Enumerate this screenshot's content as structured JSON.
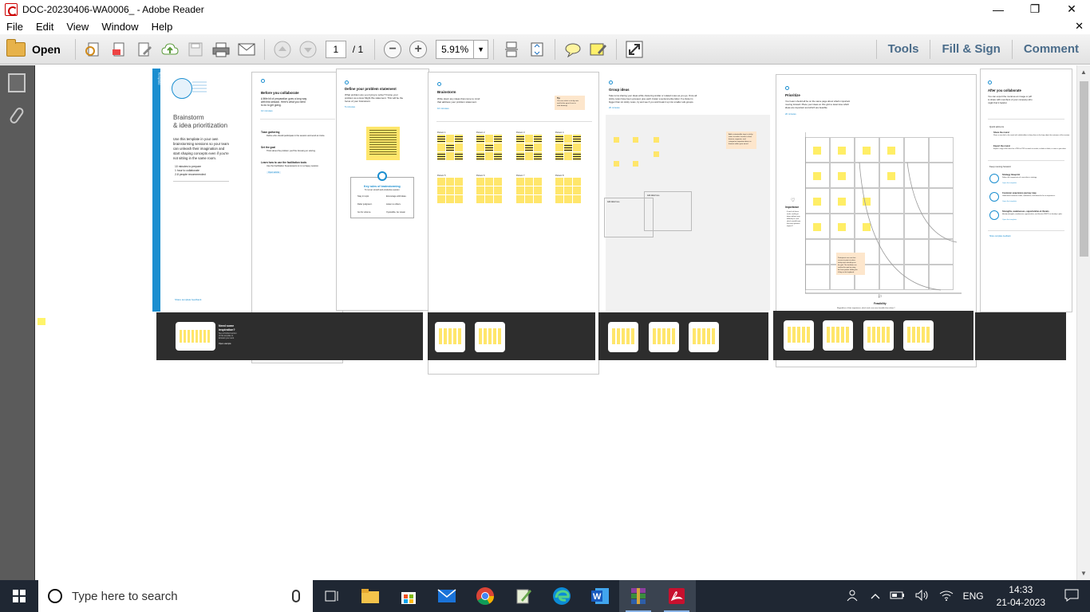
{
  "window": {
    "title": "DOC-20230406-WA0006_ - Adobe Reader",
    "controls": {
      "minimize": "—",
      "maximize": "❐",
      "close": "✕"
    }
  },
  "menu": {
    "items": [
      "File",
      "Edit",
      "View",
      "Window",
      "Help"
    ],
    "doc_close": "✕"
  },
  "toolbar": {
    "open_label": "Open",
    "page_current": "1",
    "page_total": "/ 1",
    "zoom_out": "−",
    "zoom_in": "+",
    "zoom_value": "5.91%",
    "zoom_dropdown": "▼",
    "right_tabs": [
      "Tools",
      "Fill & Sign",
      "Comment"
    ]
  },
  "scrollbar": {
    "up": "▲",
    "down": "▼"
  },
  "document": {
    "title_panel": {
      "badge": "Template",
      "heading_line1": "Brainstorm",
      "heading_line2": "& idea prioritization",
      "body": [
        "Use this template in your own",
        "brainstorming sessions so your team",
        "can unleash their imagination and",
        "start shaping concepts even if you're",
        "not sitting in the same room."
      ],
      "meta": [
        "10 minutes to prepare",
        "1 hour to collaborate",
        "2-8 people recommended"
      ],
      "footer": "Share template feedback"
    },
    "before": {
      "heading": "Before you collaborate",
      "body": [
        "A little bit of preparation goes a long way",
        "with this session. Here's what you need",
        "to do to get going."
      ],
      "time": "10 minutes",
      "steps": [
        {
          "title": "Team gathering",
          "text": "Define who should participate in the session and send an invite."
        },
        {
          "title": "Set the goal",
          "text": "Think about the problem you'll be focusing on solving."
        },
        {
          "title": "Learn how to use the facilitation tools",
          "text": "Use the Facilitation Superpowers to run a happy session."
        }
      ],
      "link": "Open article"
    },
    "define": {
      "heading": "Define your problem statement",
      "body": [
        "What problem are you trying to solve? Frame your",
        "problem as a How Might We statement. This will be the",
        "focus of your brainstorm."
      ],
      "time": "5 minutes",
      "rules_title": "Key rules of brainstorming",
      "rules_sub": "To run an smooth and productive session",
      "rules": [
        "Stay in topic.",
        "Encourage wild ideas.",
        "Defer judgment.",
        "Listen to others.",
        "Go for volume.",
        "If possible, be visual."
      ]
    },
    "brainstorm": {
      "heading": "Brainstorm",
      "body": [
        "Write down any ideas that come to mind",
        "that address your problem statement."
      ],
      "time": "10 minutes",
      "tip_title": "Tip",
      "tip_text": [
        "You can select a sticky note",
        "and hit the pencil icon to",
        "start drawing!"
      ],
      "persons": [
        "Person 1",
        "Person 2",
        "Person 3",
        "Person 4",
        "Person 5",
        "Person 6",
        "Person 7",
        "Person 8"
      ]
    },
    "group": {
      "heading": "Group ideas",
      "body": [
        "Take turns sharing your ideas while clustering similar or related notes as you go. Once all",
        "sticky notes have been grouped, give each cluster a sentence-like label. If a cluster is",
        "bigger than six sticky notes, try and see if you and break it up into smaller sub-groups."
      ],
      "time": "20 minutes",
      "tip_text": [
        "Add customizable tags to sticky",
        "notes to make it easier to find,",
        "browse, organize, and",
        "categorize important ideas as",
        "themes within your mural."
      ],
      "label_a": "Add label here",
      "label_b": "Add label here"
    },
    "prioritize": {
      "heading": "Prioritize",
      "body": [
        "Your team should all be on the same page about what's important",
        "moving forward. Place your ideas on this grid to determine which",
        "ideas are important and which are feasible."
      ],
      "time": "20 minutes",
      "importance_label": "Importance",
      "importance_text": [
        "If each of these",
        "tasks could get",
        "done without any",
        "difficulty or cost,",
        "which would have",
        "the most positive",
        "impact?"
      ],
      "feasibility_label": "Feasibility",
      "feasibility_text": "Regardless of their importance, which tasks are more feasible than others?",
      "tip_text": [
        "Participants can use their",
        "cursors to point at where",
        "sticky notes should go on",
        "the grid. The facilitator can",
        "confirm the spot by using",
        "the laser pointer holding the",
        "H key on the keyboard."
      ]
    },
    "after": {
      "heading": "After you collaborate",
      "body": [
        "You can export the mural as an image or pdf",
        "to share with members of your company who",
        "might find it helpful."
      ],
      "quick_add": "Quick add-ons",
      "share_title": "Share the mural",
      "share_text": "Share a view link to the mural with stakeholders to keep them in the loop about the outcomes of the session.",
      "export_title": "Export the mural",
      "export_text": "Export a copy of the mural as a PNG or PDF to attach to emails, include in slides, or save in your drive.",
      "keep_moving": "Keep moving forward",
      "next": [
        {
          "title": "Strategy blueprint",
          "text": "Define the components of a new idea or strategy.",
          "link": "Open the template"
        },
        {
          "title": "Customer experience journey map",
          "text": "Understand customer needs, motivations, and obstacles for an experience.",
          "link": "Open the template"
        },
        {
          "title": "Strengths, weaknesses, opportunities & threats",
          "text": "Identify strengths, weaknesses, opportunities, and threats (SWOT) to develop a plan.",
          "link": "Open the template"
        }
      ],
      "footer": "Share template feedback"
    },
    "strip": {
      "need_inspiration": [
        "Need some",
        "inspiration?"
      ],
      "need_text": [
        "See a finished version",
        "of this template to",
        "kickstart your work."
      ],
      "open_example": "Open example"
    }
  },
  "taskbar": {
    "search_placeholder": "Type here to search",
    "apps": [
      "task-view",
      "file-explorer",
      "store",
      "mail",
      "chrome",
      "notepad",
      "edge",
      "word",
      "winrar",
      "adobe-reader"
    ],
    "language": "ENG",
    "time": "14:33",
    "date": "21-04-2023"
  },
  "colors": {
    "accent_blue": "#1a8ed0",
    "sticky_yellow": "#ffe66b",
    "strip_dark": "#2d2d2d",
    "taskbar": "#1f2733",
    "nav_panel": "#5b5b5b",
    "tab_text": "#4a6c8a"
  }
}
